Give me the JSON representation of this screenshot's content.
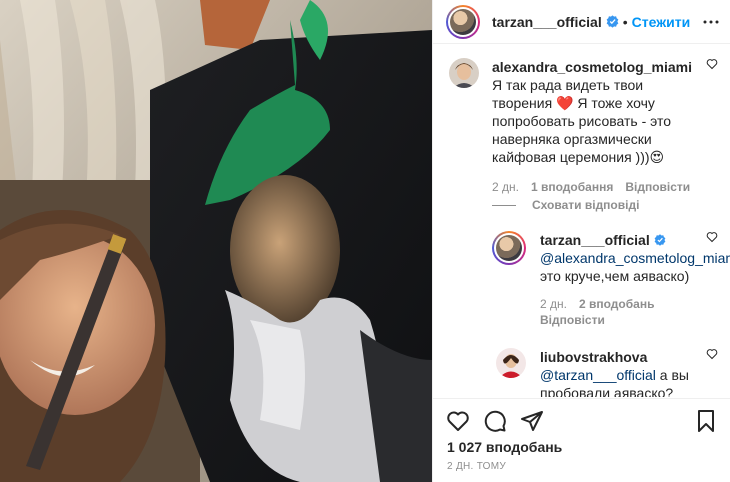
{
  "post": {
    "author": "tarzan___official",
    "follow_label": "Стежити",
    "separator": "•"
  },
  "comments": [
    {
      "user": "alexandra_cosmetolog_miami",
      "text": "Я так рада видеть твои творения ❤️ Я тоже хочу попробовать рисовать - это наверняка оргазмически кайфовая церемония )))😍",
      "time": "2 дн.",
      "likes": "1 вподобання",
      "reply_label": "Відповісти"
    }
  ],
  "hide_replies_label": "Сховати відповіді",
  "replies": [
    {
      "user": "tarzan___official",
      "mention": "@alexandra_cosmetolog_miami",
      "text": " это круче,чем аяваско)",
      "time": "2 дн.",
      "likes": "2 вподобань",
      "reply_label": "Відповісти"
    },
    {
      "user": "liubovstrakhova",
      "mention": "@tarzan___official",
      "text": " а вы пробовали аяваско?"
    }
  ],
  "footer": {
    "likes_count": "1 027 вподобань",
    "date": "2 ДН. ТОМУ"
  },
  "icons": [
    "verified-badge-icon",
    "more-options-icon",
    "heart-icon",
    "comment-icon",
    "share-icon",
    "bookmark-icon"
  ],
  "colors": {
    "link": "#0095f6",
    "mention": "#00376b",
    "muted": "#8e8e8e",
    "verified": "#3897f0"
  }
}
